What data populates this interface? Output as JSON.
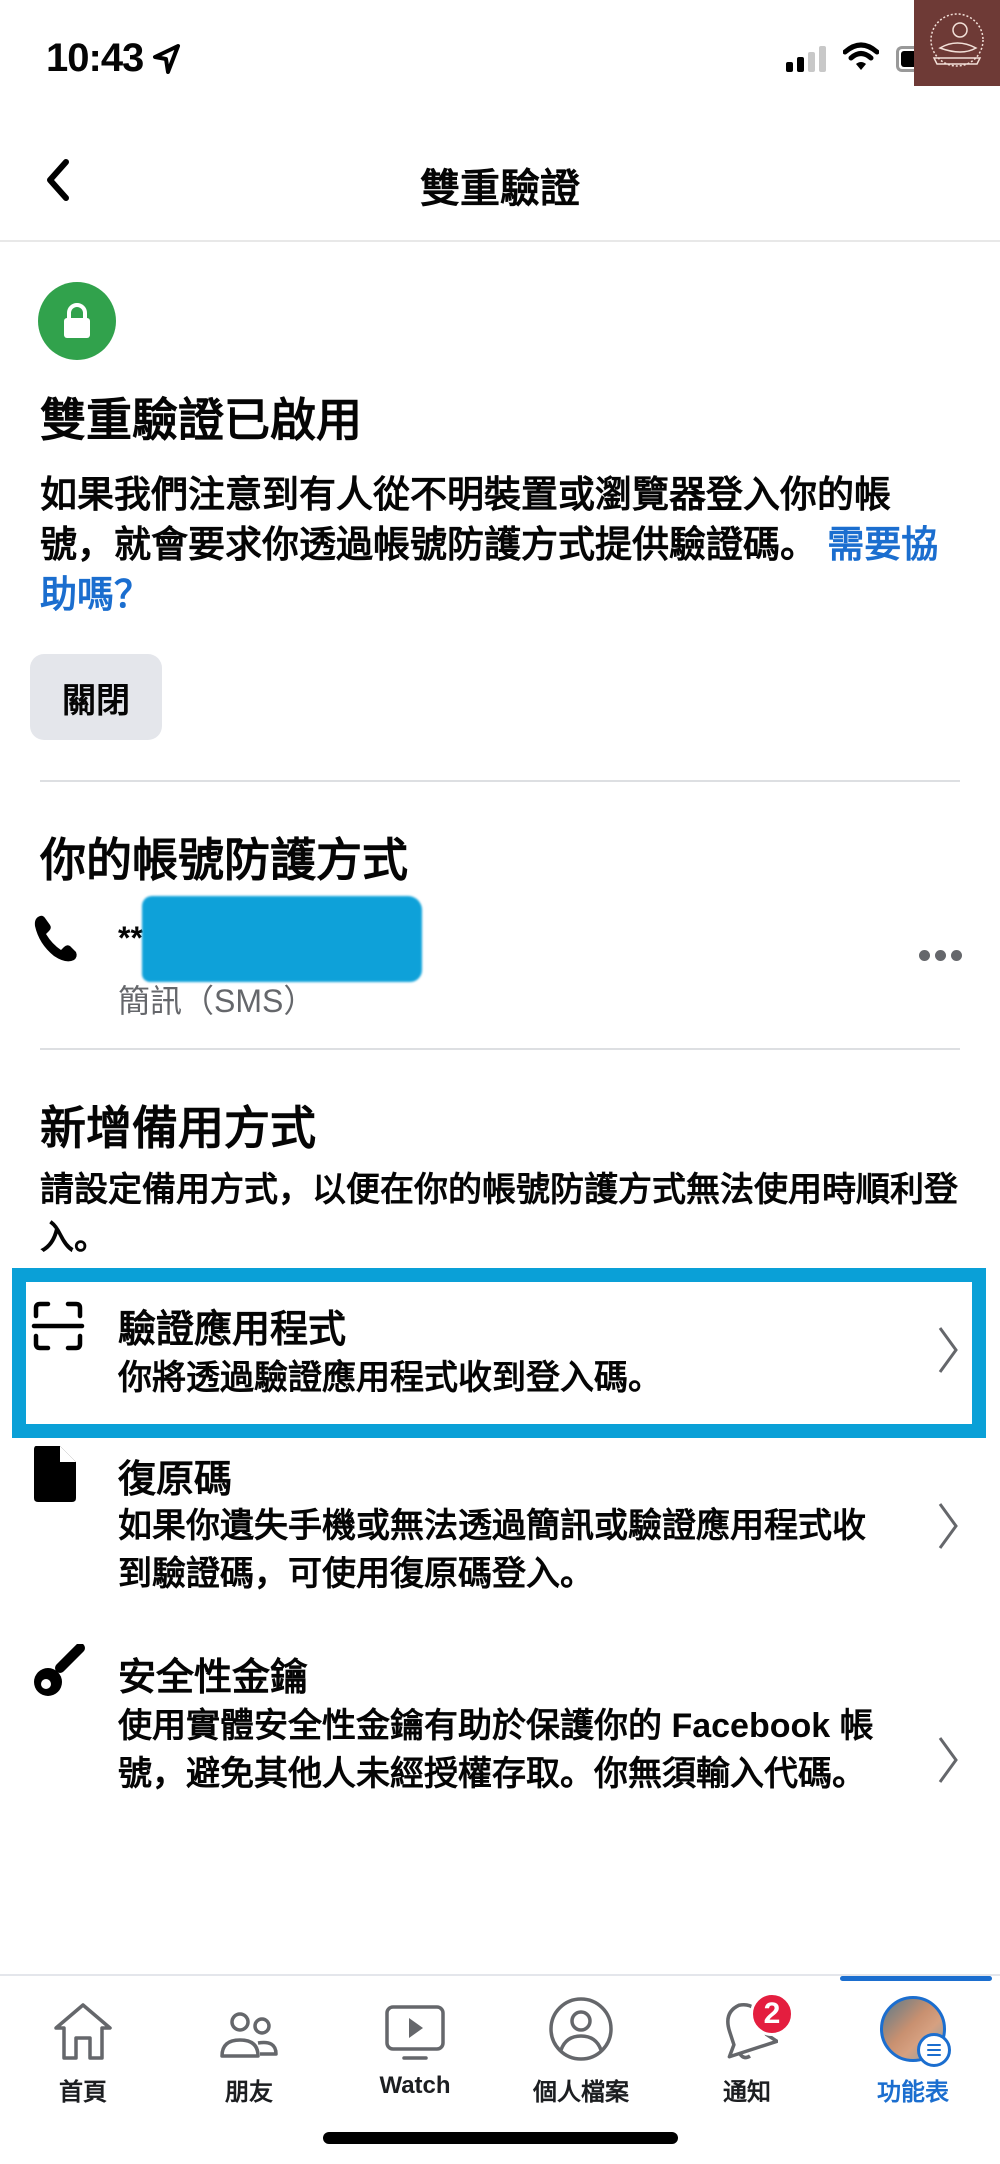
{
  "status_bar": {
    "time": "10:43",
    "icons": [
      "location-arrow-icon",
      "cellular-signal-icon",
      "wifi-icon",
      "battery-icon"
    ]
  },
  "header": {
    "back_icon": "chevron-left-icon",
    "title": "雙重驗證"
  },
  "status_section": {
    "icon": "lock-icon",
    "icon_color": "#31a24c",
    "heading": "雙重驗證已啟用",
    "description": "如果我們注意到有人從不明裝置或瀏覽器登入你的帳號，就會要求你透過帳號防護方式提供驗證碼。",
    "help_link": "需要協助嗎？",
    "close_button": "關閉"
  },
  "protection_section": {
    "heading": "你的帳號防護方式",
    "method": {
      "icon": "phone-icon",
      "value_masked": "**",
      "type_label": "簡訊（SMS）",
      "more_icon": "more-horizontal-icon"
    }
  },
  "backup_section": {
    "heading": "新增備用方式",
    "description": "請設定備用方式，以便在你的帳號防護方式無法使用時順利登入。",
    "options": [
      {
        "icon": "scan-frame-icon",
        "title": "驗證應用程式",
        "body": "你將透過驗證應用程式收到登入碼。",
        "highlighted": true
      },
      {
        "icon": "document-icon",
        "title": "復原碼",
        "body": "如果你遺失手機或無法透過簡訊或驗證應用程式收到驗證碼，可使用復原碼登入。",
        "highlighted": false
      },
      {
        "icon": "key-icon",
        "title": "安全性金鑰",
        "body": "使用實體安全性金鑰有助於保護你的 Facebook 帳號，避免其他人未經授權存取。你無須輸入代碼。",
        "highlighted": false
      }
    ],
    "highlight_color": "#0aa0d7"
  },
  "bottom_nav": {
    "items": [
      {
        "label": "首頁",
        "icon": "home-icon",
        "active": false
      },
      {
        "label": "朋友",
        "icon": "friends-icon",
        "active": false
      },
      {
        "label": "Watch",
        "icon": "watch-video-icon",
        "active": false
      },
      {
        "label": "個人檔案",
        "icon": "profile-icon",
        "active": false
      },
      {
        "label": "通知",
        "icon": "bell-icon",
        "active": false,
        "badge": "2"
      },
      {
        "label": "功能表",
        "icon": "avatar-menu-icon",
        "active": true
      }
    ],
    "active_color": "#1b6ecf",
    "badge_color": "#e41e3f"
  }
}
